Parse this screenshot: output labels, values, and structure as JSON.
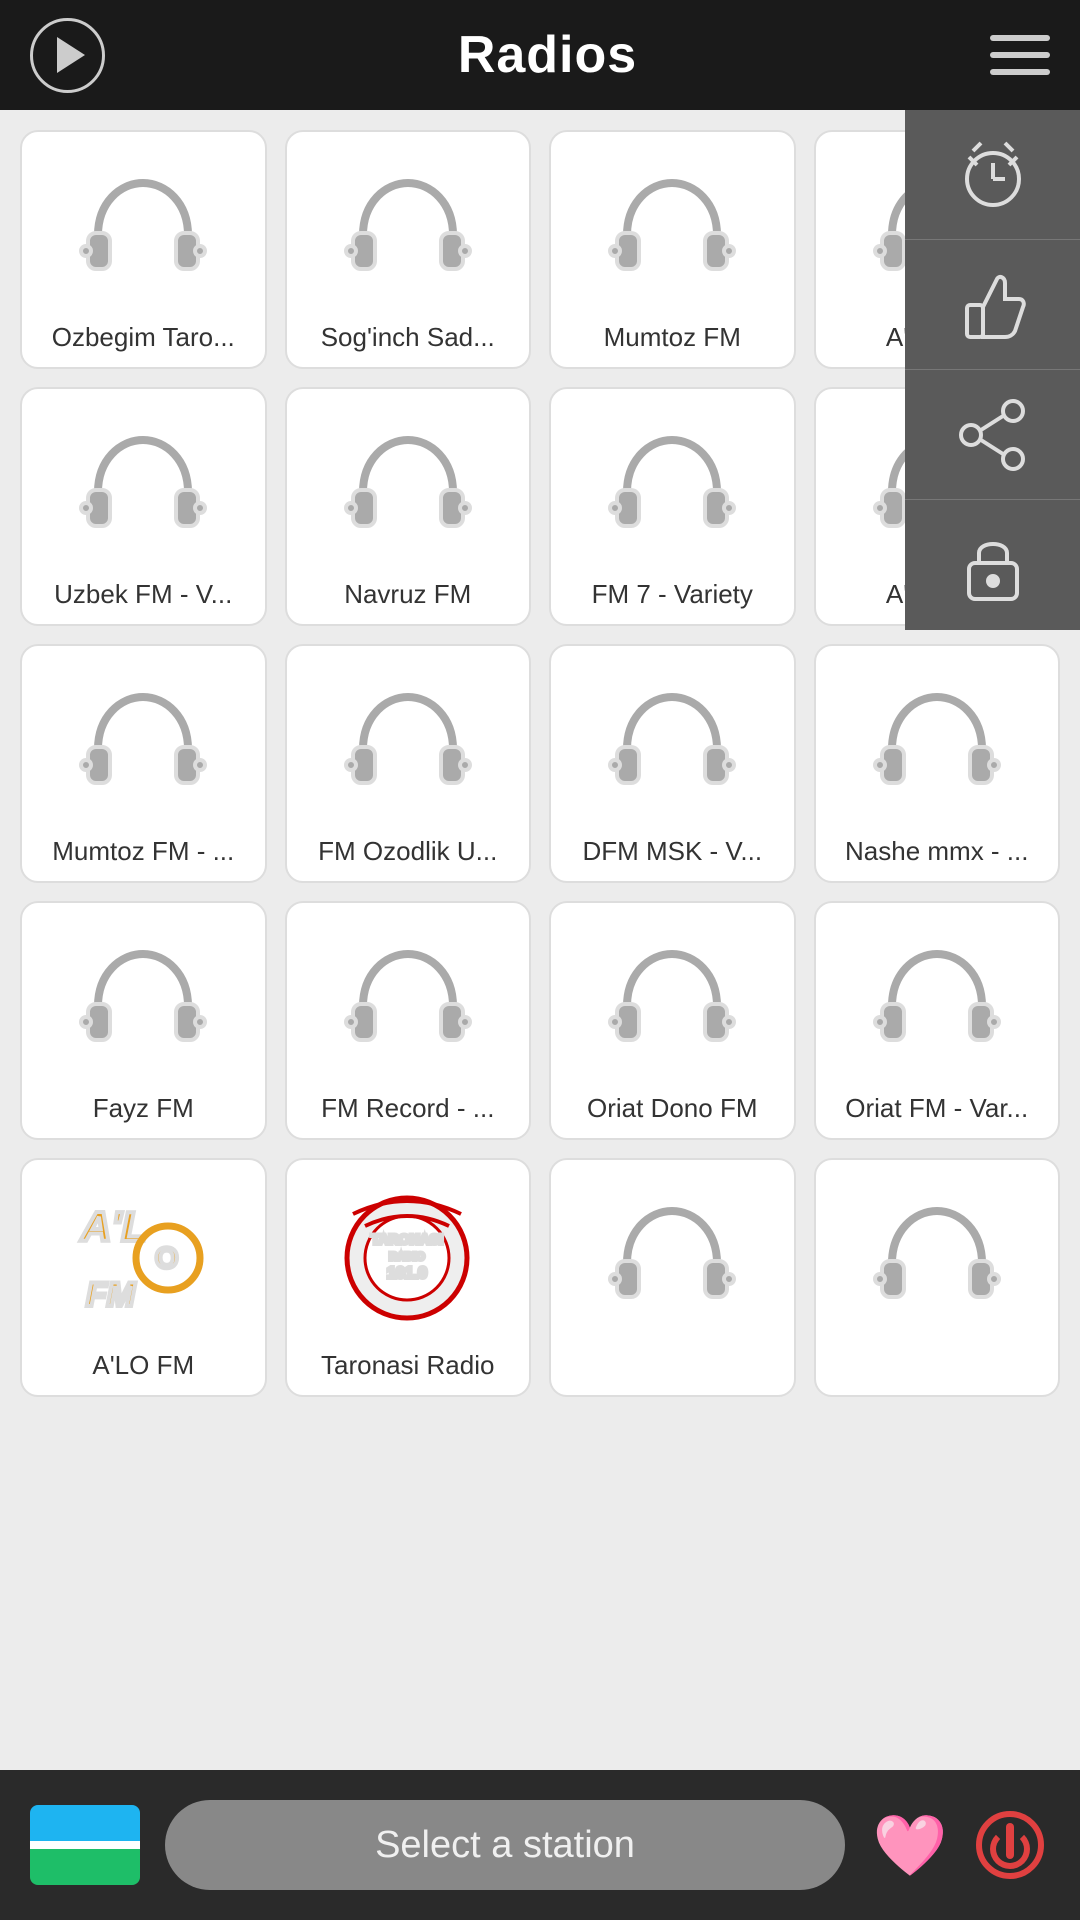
{
  "header": {
    "title": "Radios",
    "play_button_label": "Play",
    "menu_button_label": "Menu"
  },
  "sidebar": {
    "icons": [
      {
        "name": "alarm-icon",
        "label": "Alarm"
      },
      {
        "name": "thumbs-up-icon",
        "label": "Favorites"
      },
      {
        "name": "share-icon",
        "label": "Share"
      },
      {
        "name": "lock-icon",
        "label": "Lock"
      }
    ]
  },
  "stations": [
    {
      "id": 1,
      "name": "Ozbegim Taro...",
      "has_logo": false
    },
    {
      "id": 2,
      "name": "Sog'inch Sad...",
      "has_logo": false
    },
    {
      "id": 3,
      "name": "Mumtoz FM",
      "has_logo": false
    },
    {
      "id": 4,
      "name": "A'LO FM",
      "has_logo": false,
      "partial": true
    },
    {
      "id": 5,
      "name": "Uzbek FM - V...",
      "has_logo": false
    },
    {
      "id": 6,
      "name": "Navruz FM",
      "has_logo": false
    },
    {
      "id": 7,
      "name": "FM 7 - Variety",
      "has_logo": false
    },
    {
      "id": 8,
      "name": "A'LO FM",
      "has_logo": false
    },
    {
      "id": 9,
      "name": "Mumtoz FM - ...",
      "has_logo": false
    },
    {
      "id": 10,
      "name": "FM Ozodlik U...",
      "has_logo": false
    },
    {
      "id": 11,
      "name": "DFM MSK - V...",
      "has_logo": false
    },
    {
      "id": 12,
      "name": "Nashe mmx - ...",
      "has_logo": false
    },
    {
      "id": 13,
      "name": "Fayz FM",
      "has_logo": false
    },
    {
      "id": 14,
      "name": "FM Record - ...",
      "has_logo": false
    },
    {
      "id": 15,
      "name": "Oriat Dono FM",
      "has_logo": false
    },
    {
      "id": 16,
      "name": "Oriat FM - Var...",
      "has_logo": false
    },
    {
      "id": 17,
      "name": "A'LO FM",
      "has_logo": true,
      "logo_type": "alo"
    },
    {
      "id": 18,
      "name": "Taronasi Radio",
      "has_logo": true,
      "logo_type": "taronasi"
    },
    {
      "id": 19,
      "name": "",
      "has_logo": false
    },
    {
      "id": 20,
      "name": "",
      "has_logo": false
    }
  ],
  "bottom_bar": {
    "select_station_text": "Select a station",
    "flag_country": "Uzbekistan",
    "heart_label": "Favorites",
    "power_label": "Power"
  }
}
